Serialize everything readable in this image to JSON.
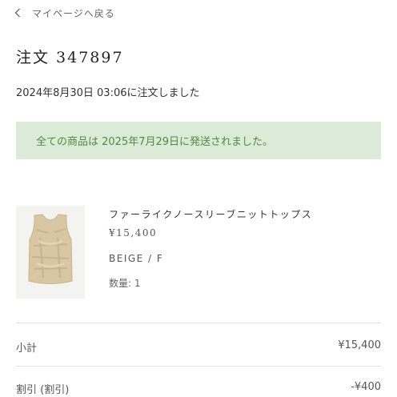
{
  "nav": {
    "back_label": "マイページへ戻る",
    "back_icon": "chevron-left-icon"
  },
  "order": {
    "title": "注文 347897",
    "placed_text": "2024年8月30日 03:06に注文しました",
    "shipping_notice": "全ての商品は 2025年7月29日に発送されました。"
  },
  "item": {
    "name": "ファーライクノースリーブニットトップス",
    "price": "¥15,400",
    "variant": "BEIGE / F",
    "quantity_text": "数量: 1"
  },
  "summary": {
    "subtotal_label": "小計",
    "subtotal_value": "¥15,400",
    "discount_label": "割引 (割引)",
    "discount_value": "-¥400"
  },
  "colors": {
    "notice_background": "#dcebd7",
    "notice_text": "#4e8a3f",
    "divider": "#e3e3e3"
  }
}
